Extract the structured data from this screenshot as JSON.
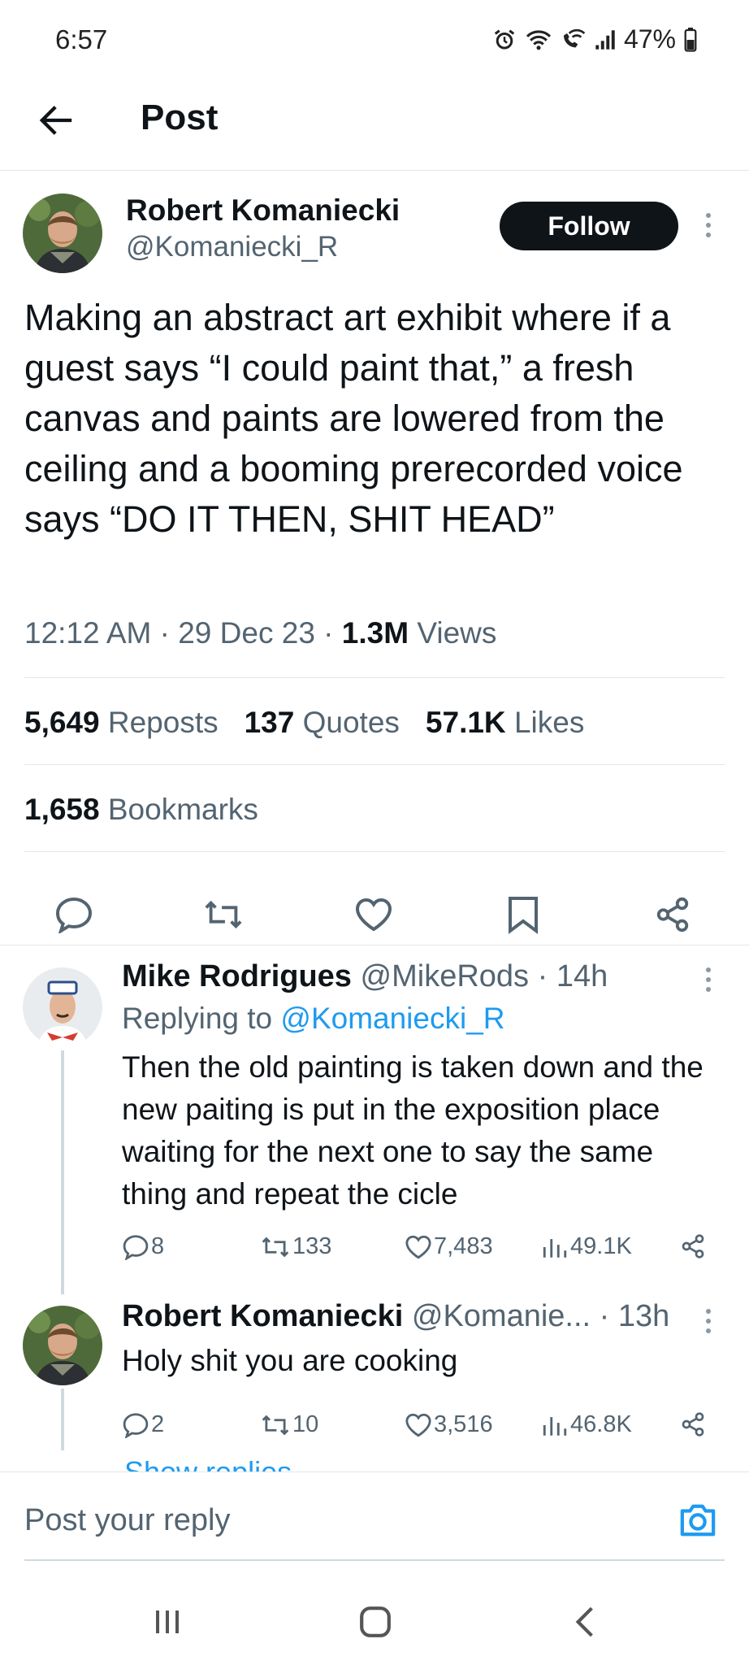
{
  "status_bar": {
    "time": "6:57",
    "battery": "47%"
  },
  "header": {
    "title": "Post"
  },
  "post": {
    "author_name": "Robert Komaniecki",
    "author_handle": "@Komaniecki_R",
    "follow_label": "Follow",
    "text": "Making an abstract art exhibit where if a guest says “I could paint that,” a fresh canvas and paints are lowered from the ceiling and a booming prerecorded voice says “DO IT THEN, SHIT HEAD”",
    "time": "12:12 AM",
    "date": "29 Dec 23",
    "views_count": "1.3M",
    "views_label": "Views",
    "reposts_count": "5,649",
    "reposts_label": "Reposts",
    "quotes_count": "137",
    "quotes_label": "Quotes",
    "likes_count": "57.1K",
    "likes_label": "Likes",
    "bookmarks_count": "1,658",
    "bookmarks_label": "Bookmarks"
  },
  "replies": [
    {
      "name": "Mike Rodrigues",
      "handle": "@MikeRods",
      "time": "14h",
      "replying_to_label": "Replying to",
      "replying_to_handle": "@Komaniecki_R",
      "text": "Then the old painting is taken down and the new paiting is put in the exposition place waiting for the next one to say the same thing and repeat the cicle",
      "comments": "8",
      "reposts": "133",
      "likes": "7,483",
      "views": "49.1K"
    },
    {
      "name": "Robert Komaniecki",
      "handle": "@Komanie...",
      "time": "13h",
      "text": "Holy shit you are cooking",
      "comments": "2",
      "reposts": "10",
      "likes": "3,516",
      "views": "46.8K"
    }
  ],
  "show_replies_label": "Show replies",
  "reply_box": {
    "placeholder": "Post your reply"
  },
  "icons": {
    "comment": "comment-icon",
    "repost": "repost-icon",
    "like": "heart-icon",
    "bookmark": "bookmark-icon",
    "share": "share-icon",
    "views": "views-icon",
    "camera": "camera-icon"
  },
  "colors": {
    "link": "#1d9bf0",
    "muted": "#536471",
    "text": "#0f1419",
    "follow_bg": "#0f1419"
  }
}
